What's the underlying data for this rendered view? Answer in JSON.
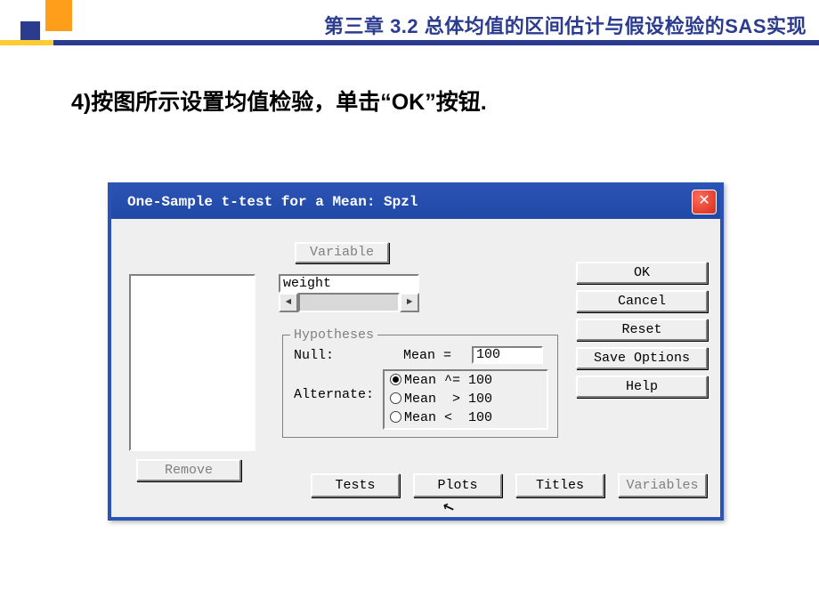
{
  "header": {
    "chapter_title": "第三章  3.2 总体均值的区间估计与假设检验的SAS实现"
  },
  "instruction": "4)按图所示设置均值检验，单击“OK”按钮.",
  "dialog": {
    "title": "One-Sample t-test for a Mean: Spzl",
    "variable_btn": "Variable",
    "variable_value": "weight",
    "remove_btn": "Remove",
    "hypotheses": {
      "legend": "Hypotheses",
      "null_label": "Null:",
      "mean_label": "Mean  =",
      "mean_value": "100",
      "alternate_label": "Alternate:",
      "opt_ne": "Mean ^= 100",
      "opt_gt": "Mean  > 100",
      "opt_lt": "Mean <  100"
    },
    "right_buttons": {
      "ok": "OK",
      "cancel": "Cancel",
      "reset": "Reset",
      "save": "Save Options",
      "help": "Help"
    },
    "bottom_buttons": {
      "tests": "Tests",
      "plots": "Plots",
      "titles": "Titles",
      "variables": "Variables"
    }
  }
}
